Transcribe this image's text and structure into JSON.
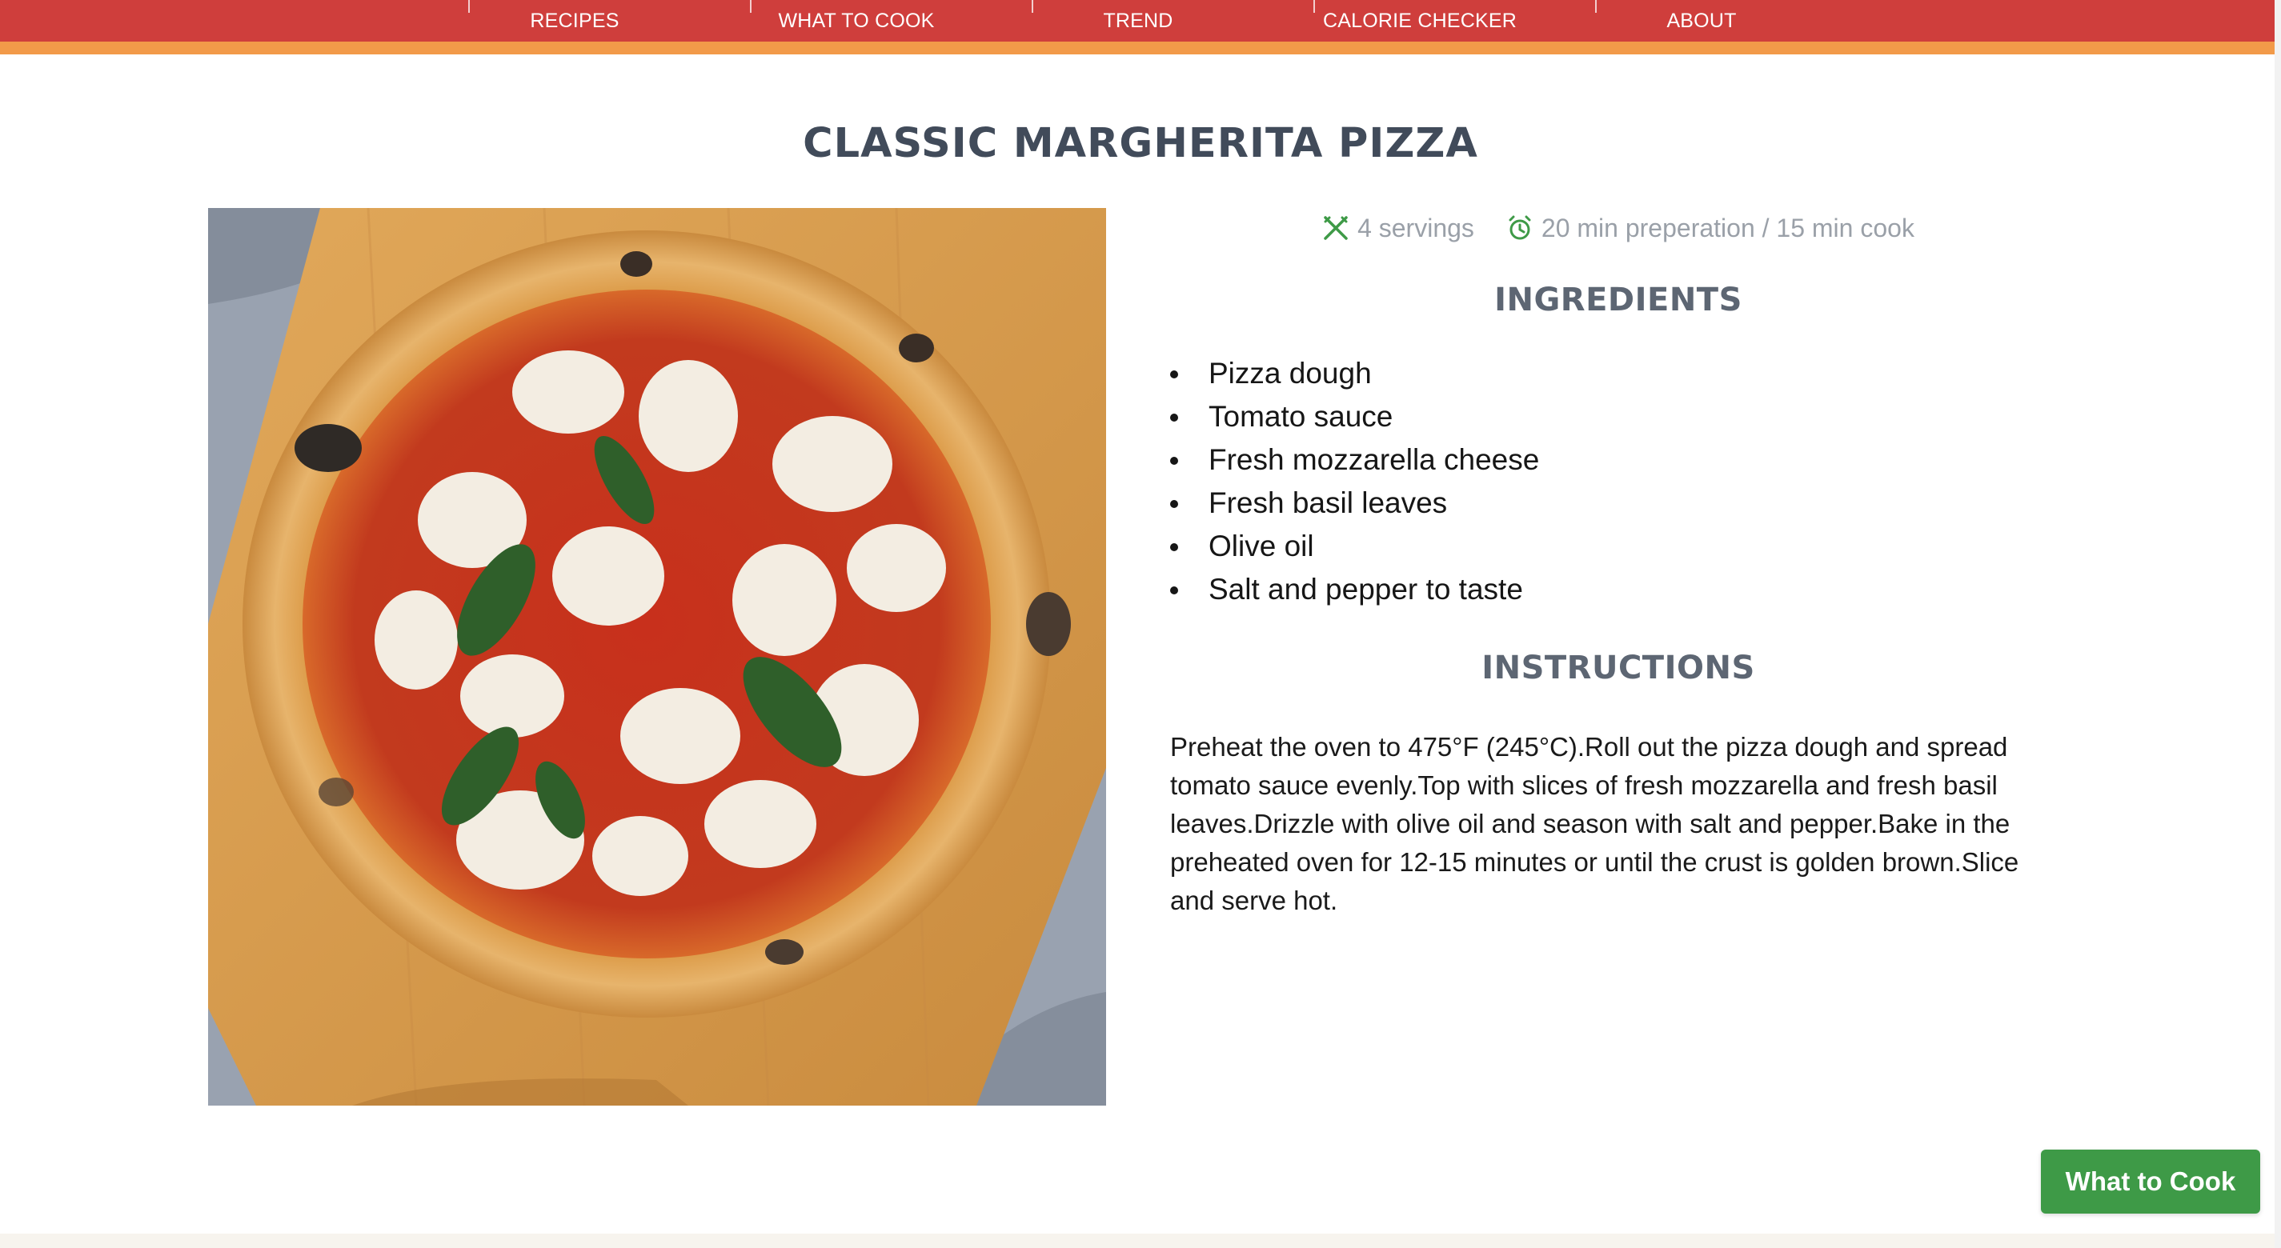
{
  "nav": {
    "items": [
      {
        "label": "RECIPES"
      },
      {
        "label": "WHAT TO COOK"
      },
      {
        "label": "TREND"
      },
      {
        "label": "CALORIE CHECKER"
      },
      {
        "label": "ABOUT"
      }
    ]
  },
  "recipe": {
    "title": "CLASSIC MARGHERITA PIZZA",
    "image_icon": "pizza-photo",
    "servings": "4 servings",
    "servings_icon": "utensils-icon",
    "time": "20 min preperation / 15 min cook",
    "time_icon": "alarm-clock-icon",
    "ingredients_heading": "INGREDIENTS",
    "ingredients": [
      "Pizza dough",
      "Tomato sauce",
      "Fresh mozzarella cheese",
      "Fresh basil leaves",
      "Olive oil",
      "Salt and pepper to taste"
    ],
    "instructions_heading": "INSTRUCTIONS",
    "instructions": "Preheat the oven to 475°F (245°C).Roll out the pizza dough and spread tomato sauce evenly.Top with slices of fresh mozzarella and fresh basil leaves.Drizzle with olive oil and season with salt and pepper.Bake in the preheated oven for 12-15 minutes or until the crust is golden brown.Slice and serve hot."
  },
  "cta": {
    "label": "What to Cook"
  },
  "colors": {
    "nav_red": "#cf3e3c",
    "nav_orange": "#f29a49",
    "accent_green": "#3e9a47",
    "title_gray": "#414b5a"
  }
}
